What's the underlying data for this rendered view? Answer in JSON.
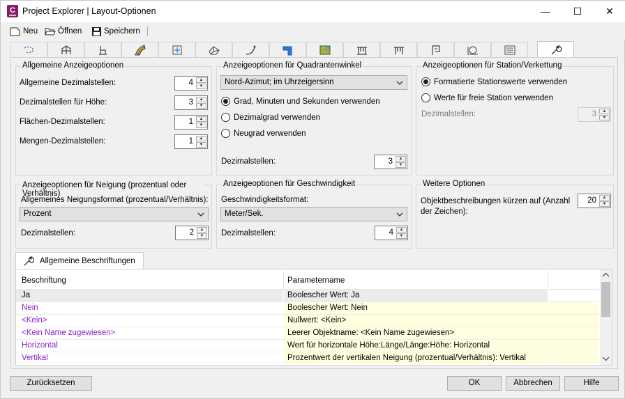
{
  "window": {
    "title": "Project Explorer | Layout-Optionen",
    "app_icon_letter": "C",
    "minimize": "—",
    "maximize": "☐",
    "close": "✕"
  },
  "toolbar": {
    "new_label": "Neu",
    "open_label": "Öffnen",
    "save_label": "Speichern"
  },
  "tabs": [
    "alignment-icon",
    "profile-icon",
    "station-icon",
    "road-icon",
    "offset-icon",
    "surface-icon",
    "curve-icon",
    "corridor-icon",
    "map-icon",
    "bridge-icon",
    "bridge2-icon",
    "flag-icon",
    "target-icon",
    "list-icon",
    "wrench-icon"
  ],
  "general": {
    "title": "Allgemeine Anzeigeoptionen",
    "rows": [
      {
        "label": "Allgemeine Dezimalstellen:",
        "value": "4"
      },
      {
        "label": "Dezimalstellen für Höhe:",
        "value": "3"
      },
      {
        "label": "Flächen-Dezimalstellen:",
        "value": "1"
      },
      {
        "label": "Mengen-Dezimalstellen:",
        "value": "1"
      }
    ]
  },
  "quadrant": {
    "title": "Anzeigeoptionen für Quadrantenwinkel",
    "combo_value": "Nord-Azimut; im Uhrzeigersinn",
    "radios": [
      {
        "label": "Grad, Minuten und Sekunden verwenden",
        "checked": true
      },
      {
        "label": "Dezimalgrad verwenden",
        "checked": false
      },
      {
        "label": "Neugrad verwenden",
        "checked": false
      }
    ],
    "decimals_label": "Dezimalstellen:",
    "decimals_value": "3"
  },
  "station": {
    "title": "Anzeigeoptionen für Station/Verkettung",
    "radios": [
      {
        "label": "Formatierte Stationswerte verwenden",
        "checked": true
      },
      {
        "label": "Werte für freie Station verwenden",
        "checked": false
      }
    ],
    "decimals_label": "Dezimalstellen:",
    "decimals_value": "3"
  },
  "slope": {
    "title": "Anzeigeoptionen für Neigung (prozentual oder Verhältnis)",
    "format_label": "Allgemeines Neigungsformat (prozentual/Verhältnis):",
    "combo_value": "Prozent",
    "decimals_label": "Dezimalstellen:",
    "decimals_value": "2"
  },
  "speed": {
    "title": "Anzeigeoptionen für Geschwindigkeit",
    "format_label": "Geschwindigkeitsformat:",
    "combo_value": "Meter/Sek.",
    "decimals_label": "Dezimalstellen:",
    "decimals_value": "4"
  },
  "more": {
    "title": "Weitere Optionen",
    "label_line1": "Objektbeschreibungen kürzen auf (Anzahl",
    "label_line2": "der Zeichen):",
    "value": "20"
  },
  "labels_tab": {
    "title": "Allgemeine Beschriftungen",
    "col1": "Beschriftung",
    "col2": "Parametername",
    "rows": [
      {
        "caption": "Ja",
        "param": "Boolescher Wert: Ja",
        "purple": false
      },
      {
        "caption": "Nein",
        "param": "Boolescher Wert: Nein",
        "purple": true
      },
      {
        "caption": "<Kein>",
        "param": "Nullwert: <Kein>",
        "purple": true
      },
      {
        "caption": "<Kein Name zugewiesen>",
        "param": "Leerer Objektname: <Kein Name zugewiesen>",
        "purple": true
      },
      {
        "caption": "Horizontal",
        "param": "Wert für horizontale Höhe:Länge/Länge:Höhe: Horizontal",
        "purple": true
      },
      {
        "caption": "Vertikal",
        "param": "Prozentwert der vertikalen Neigung (prozentual/Verhältnis): Vertikal",
        "purple": true
      }
    ]
  },
  "buttons": {
    "reset": "Zurücksetzen",
    "ok": "OK",
    "cancel": "Abbrechen",
    "help": "Hilfe"
  },
  "colors": {
    "accent_purple": "#8a22c8",
    "cell_yellow": "#ffffe0",
    "app_icon": "#8a1b6b"
  }
}
